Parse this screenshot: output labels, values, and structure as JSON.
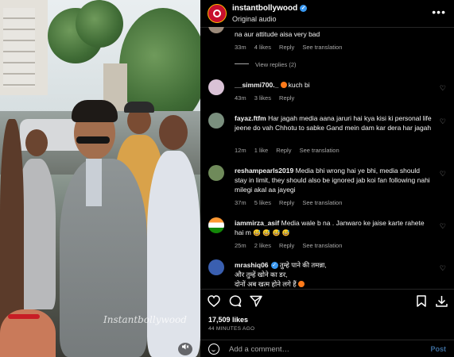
{
  "post": {
    "username": "instantbollywood",
    "audio_label": "Original audio",
    "watermark": "Instantbollywood",
    "more_icon": "ellipsis-icon",
    "mute_icon": "speaker-muted-icon"
  },
  "comments": [
    {
      "id": "c0",
      "username": "",
      "text": "na aur attitude aisa very bad",
      "time": "33m",
      "likes": "4 likes",
      "reply": "Reply",
      "translation": "See translation",
      "view_replies": "View replies (2)",
      "avatar_color": "#9b8a7a"
    },
    {
      "id": "c1",
      "username": "__simmi700._",
      "text": "kuch bi",
      "emoji": "grinning-face",
      "time": "43m",
      "likes": "3 likes",
      "reply": "Reply",
      "translation": "",
      "avatar_color": "#d9c2d6"
    },
    {
      "id": "c2",
      "username": "fayaz.ftfm",
      "text": "Har jagah media aana jaruri hai kya kisi ki personal life jeene do vah Chhotu to sabke Gand mein dam kar dera har jagah",
      "time": "12m",
      "likes": "1 like",
      "reply": "Reply",
      "translation": "See translation",
      "avatar_color": "#7a8f7e"
    },
    {
      "id": "c3",
      "username": "reshampearls2019",
      "text": "Media bhi wrong hai ye bhi, media should stay in limit, they should also be ignored jab koi fan following nahi milegi akal aa jayegi",
      "time": "37m",
      "likes": "5 likes",
      "reply": "Reply",
      "translation": "See translation",
      "avatar_color": "#6f8a5a"
    },
    {
      "id": "c4",
      "username": "iammirza_asif",
      "text": "Media wale b na . Janwaro ke jaise karte rahete hai m",
      "emoji_row": "😅 😅 😅 😅",
      "time": "25m",
      "likes": "2 likes",
      "reply": "Reply",
      "translation": "See translation",
      "avatar_color": "#ff9933"
    },
    {
      "id": "c5",
      "username": "mrashiq06",
      "line1": "तुम्हे पाने की तमन्ना,",
      "line2": "और तुम्हें खोने का डर,",
      "line3": "दोनों अब खत्म होने लगे हैं",
      "avatar_color": "#3a5fb0"
    }
  ],
  "actions": {
    "like_icon": "heart-icon",
    "comment_icon": "comment-bubble-icon",
    "share_icon": "paper-plane-icon",
    "save_icon": "bookmark-icon",
    "download_icon": "download-icon"
  },
  "stats": {
    "likes": "17,509 likes",
    "time_ago": "44 MINUTES AGO"
  },
  "composer": {
    "placeholder": "Add a comment…",
    "post_label": "Post"
  },
  "colors": {
    "verified": "#3897f0",
    "post_button": "#3c6b9a",
    "muted_text": "#a8a8a8"
  }
}
